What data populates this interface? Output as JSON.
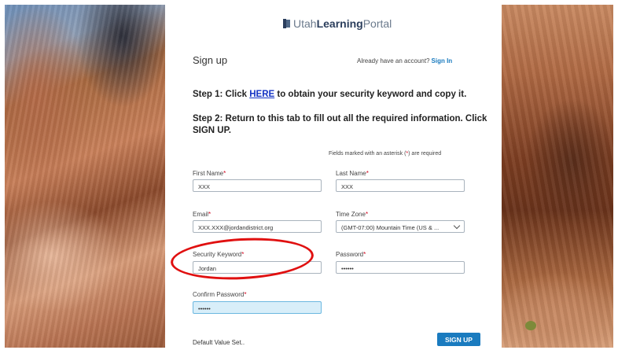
{
  "brand": {
    "prefix": "Utah",
    "strong": "Learning",
    "suffix": "Portal"
  },
  "header": {
    "title": "Sign up",
    "have_account_text": "Already have an account?",
    "sign_in_link": "Sign In"
  },
  "instructions": {
    "step1_prefix": "Step 1: Click ",
    "step1_link": "HERE",
    "step1_suffix": " to obtain your security keyword and copy it.",
    "step2": "Step 2: Return to this tab to fill out all the required information. Click SIGN UP."
  },
  "required_note": {
    "before": "Fields marked with an asterisk (",
    "asterisk": "*",
    "after": ") are required"
  },
  "form": {
    "first_name": {
      "label": "First Name",
      "value": "XXX"
    },
    "last_name": {
      "label": "Last Name",
      "value": "XXX"
    },
    "email": {
      "label": "Email",
      "value": "XXX.XXX@jordandistrict.org"
    },
    "time_zone": {
      "label": "Time Zone",
      "value": "(GMT-07:00) Mountain Time (US & ..."
    },
    "security_keyword": {
      "label": "Security Keyword",
      "value": "Jordan"
    },
    "password": {
      "label": "Password",
      "value": "••••••"
    },
    "confirm_password": {
      "label": "Confirm Password",
      "value": "••••••"
    },
    "required_marker": "*"
  },
  "footer": {
    "default_value_text": "Default Value Set..",
    "signup_button": "SIGN UP"
  },
  "colors": {
    "accent": "#1a7bbf",
    "required": "#d0021b",
    "annotation_circle": "#e01010"
  }
}
